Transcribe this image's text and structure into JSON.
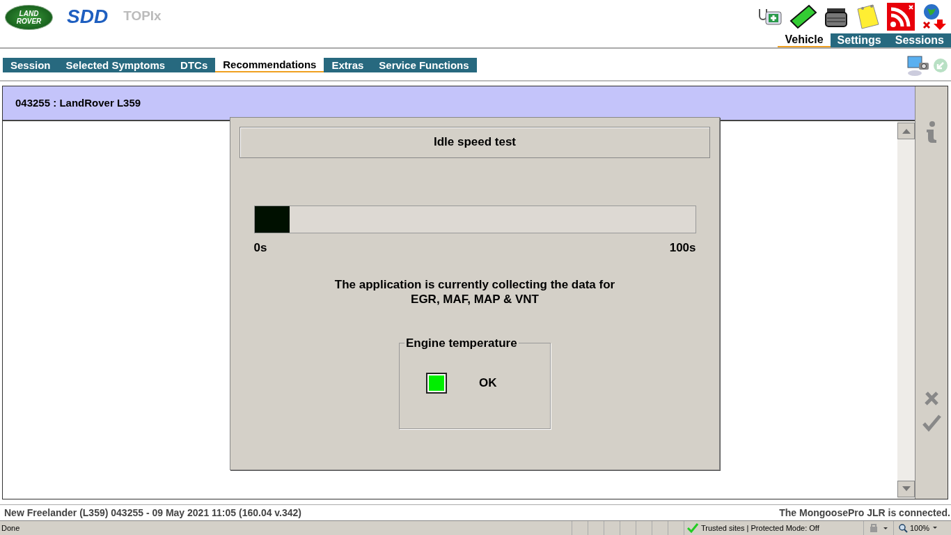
{
  "header": {
    "logo_top": "LAND",
    "logo_bottom": "ROVER",
    "app_name": "SDD",
    "module": "TOPIx"
  },
  "top_tabs": [
    {
      "label": "Vehicle",
      "selected": true
    },
    {
      "label": "Settings",
      "selected": false
    },
    {
      "label": "Sessions",
      "selected": false
    }
  ],
  "nav_tabs": [
    {
      "label": "Session",
      "selected": false
    },
    {
      "label": "Selected Symptoms",
      "selected": false
    },
    {
      "label": "DTCs",
      "selected": false
    },
    {
      "label": "Recommendations",
      "selected": true
    },
    {
      "label": "Extras",
      "selected": false
    },
    {
      "label": "Service Functions",
      "selected": false
    }
  ],
  "vehicle_bar": {
    "title": "043255 : LandRover L359"
  },
  "dialog": {
    "title": "Idle speed test",
    "progress": {
      "level": 0.08,
      "min_label": "0s",
      "max_label": "100s"
    },
    "message": "The application is currently collecting the data for\nEGR, MAF, MAP & VNT",
    "group": {
      "title": "Engine temperature",
      "indicator": {
        "color": "#00ee00"
      },
      "status": "OK"
    }
  },
  "footer": {
    "session_info": "New Freelander (L359) 043255 - 09 May 2021 11:05 (160.04 v.342)",
    "connection": "The MongoosePro JLR is connected."
  },
  "status_bar": {
    "text": "Done",
    "zone": "Trusted sites | Protected Mode: Off",
    "zoom": "100%"
  }
}
